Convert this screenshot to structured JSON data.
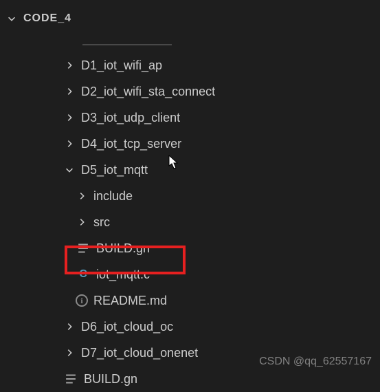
{
  "root": {
    "name": "CODE_4"
  },
  "tree": [
    {
      "label": "D1_iot_wifi_ap",
      "type": "folder",
      "expanded": false,
      "depth": 1
    },
    {
      "label": "D2_iot_wifi_sta_connect",
      "type": "folder",
      "expanded": false,
      "depth": 1
    },
    {
      "label": "D3_iot_udp_client",
      "type": "folder",
      "expanded": false,
      "depth": 1
    },
    {
      "label": "D4_iot_tcp_server",
      "type": "folder",
      "expanded": false,
      "depth": 1
    },
    {
      "label": "D5_iot_mqtt",
      "type": "folder",
      "expanded": true,
      "depth": 1
    },
    {
      "label": "include",
      "type": "folder",
      "expanded": false,
      "depth": 2
    },
    {
      "label": "src",
      "type": "folder",
      "expanded": false,
      "depth": 2
    },
    {
      "label": "BUILD.gn",
      "type": "file-build",
      "depth": 2
    },
    {
      "label": "iot_mqtt.c",
      "type": "file-c",
      "depth": 2,
      "highlighted": true
    },
    {
      "label": "README.md",
      "type": "file-info",
      "depth": 2
    },
    {
      "label": "D6_iot_cloud_oc",
      "type": "folder",
      "expanded": false,
      "depth": 1
    },
    {
      "label": "D7_iot_cloud_onenet",
      "type": "folder",
      "expanded": false,
      "depth": 1
    },
    {
      "label": "BUILD.gn",
      "type": "file-build",
      "depth": 1
    }
  ],
  "watermark": "CSDN @qq_62557167"
}
